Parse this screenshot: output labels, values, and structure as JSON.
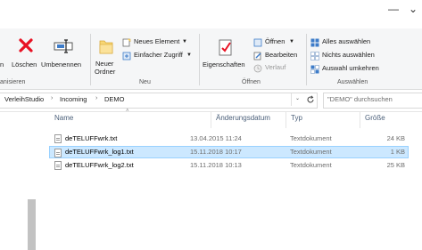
{
  "ribbon": {
    "groups": {
      "organize": "anisieren",
      "new": "Neu",
      "open": "Öffnen",
      "select": "Auswählen"
    },
    "buttons": {
      "move_partial": "n",
      "delete": "Löschen",
      "rename": "Umbenennen",
      "new_folder_line1": "Neuer",
      "new_folder_line2": "Ordner",
      "new_item": "Neues Element",
      "easy_access": "Einfacher Zugriff",
      "properties": "Eigenschaften",
      "open": "Öffnen",
      "edit": "Bearbeiten",
      "history": "Verlauf",
      "select_all": "Alles auswählen",
      "select_none": "Nichts auswählen",
      "invert_selection": "Auswahl umkehren"
    }
  },
  "address": {
    "crumbs": [
      "VerleihStudio",
      "Incoming",
      "DEMO"
    ],
    "search_placeholder": "\"DEMO\" durchsuchen"
  },
  "columns": {
    "name": "Name",
    "date": "Änderungsdatum",
    "type": "Typ",
    "size": "Größe"
  },
  "files": [
    {
      "name": "deTELUFFwrk.txt",
      "date": "13.04.2015 11:24",
      "type": "Textdokument",
      "size": "24 KB"
    },
    {
      "name": "deTELUFFwrk_log1.txt",
      "date": "15.11.2018 10:17",
      "type": "Textdokument",
      "size": "1 KB"
    },
    {
      "name": "deTELUFFwrk_log2.txt",
      "date": "15.11.2018 10:13",
      "type": "Textdokument",
      "size": "25 KB"
    }
  ],
  "selected_index": 1,
  "colors": {
    "selection_fill": "#cce8ff",
    "selection_border": "#99d1ff",
    "delete_red": "#e81123",
    "folder_yellow": "#f8d775"
  }
}
